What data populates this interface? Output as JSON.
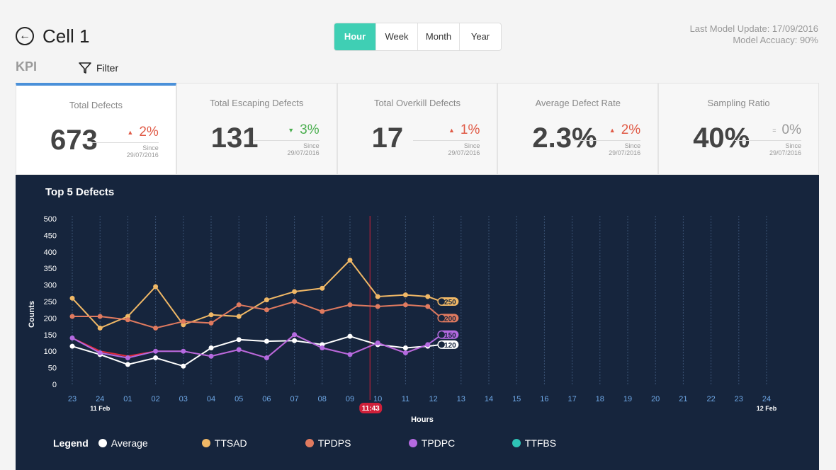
{
  "header": {
    "back_icon": "arrow-left-circle-icon",
    "title": "Cell 1",
    "kpi_label": "KPI",
    "filter_label": "Filter",
    "filter_icon": "funnel-icon",
    "last_update": "Last Model Update: 17/09/2016",
    "model_accuracy": "Model Accuacy: 90%"
  },
  "time_range": {
    "options": [
      "Hour",
      "Week",
      "Month",
      "Year"
    ],
    "selected": "Hour"
  },
  "kpi_cards": [
    {
      "title": "Total Defects",
      "value": "673",
      "direction": "up",
      "change": "2%",
      "since_label": "Since",
      "since_date": "29/07/2016",
      "color": "#e05a46",
      "active": true
    },
    {
      "title": "Total Escaping Defects",
      "value": "131",
      "direction": "down",
      "change": "3%",
      "since_label": "Since",
      "since_date": "29/07/2016",
      "color": "#4caf50",
      "active": false
    },
    {
      "title": "Total Overkill Defects",
      "value": "17",
      "direction": "up",
      "change": "1%",
      "since_label": "Since",
      "since_date": "29/07/2016",
      "color": "#e05a46",
      "active": false
    },
    {
      "title": "Average Defect Rate",
      "value": "2.3%",
      "direction": "up",
      "change": "2%",
      "since_label": "Since",
      "since_date": "29/07/2016",
      "color": "#e05a46",
      "active": false
    },
    {
      "title": "Sampling Ratio",
      "value": "40%",
      "direction": "equal",
      "change": "0%",
      "since_label": "Since",
      "since_date": "29/07/2016",
      "color": "#999999",
      "active": false
    }
  ],
  "chart_panel": {
    "title": "Top 5 Defects",
    "legend_title": "Legend"
  },
  "chart_data": {
    "type": "line",
    "title": "Top 5 Defects",
    "xlabel": "Hours",
    "ylabel": "Counts",
    "ylim": [
      0,
      500
    ],
    "yticks": [
      0,
      50,
      100,
      150,
      200,
      250,
      300,
      350,
      400,
      450,
      500
    ],
    "x_ticks": [
      "23",
      "24",
      "01",
      "02",
      "03",
      "04",
      "05",
      "06",
      "07",
      "08",
      "09",
      "10",
      "11",
      "12",
      "13",
      "14",
      "15",
      "16",
      "17",
      "18",
      "19",
      "20",
      "21",
      "22",
      "23",
      "24"
    ],
    "date_labels": [
      {
        "after_tick": "24",
        "index": 1,
        "label": "11 Feb"
      },
      {
        "after_tick": "24",
        "index": 25,
        "label": "12 Feb"
      }
    ],
    "now_marker": "11:43",
    "now_x": 10.72,
    "grid": true,
    "legend_position": "bottom",
    "series": [
      {
        "name": "Average",
        "color": "#ffffff",
        "x": [
          0,
          1,
          2,
          3,
          4,
          5,
          6,
          7,
          8,
          9,
          10,
          11,
          12,
          12.8,
          13.3
        ],
        "y": [
          115,
          90,
          60,
          80,
          55,
          110,
          135,
          130,
          132,
          120,
          145,
          120,
          110,
          115,
          120
        ],
        "end_label": "120"
      },
      {
        "name": "TTSAD",
        "color": "#f0b866",
        "x": [
          0,
          1,
          2,
          3,
          4,
          5,
          6,
          7,
          8,
          9,
          10,
          11,
          12,
          12.8,
          13.3
        ],
        "y": [
          260,
          170,
          205,
          295,
          180,
          210,
          205,
          255,
          280,
          290,
          375,
          265,
          270,
          265,
          250
        ],
        "end_label": "250"
      },
      {
        "name": "TPDPS",
        "color": "#e07a5f",
        "x": [
          0,
          1,
          2,
          3,
          4,
          5,
          6,
          7,
          8,
          9,
          10,
          11,
          12,
          12.8,
          13.3
        ],
        "y": [
          205,
          205,
          195,
          170,
          190,
          185,
          240,
          225,
          250,
          220,
          240,
          235,
          240,
          235,
          200
        ],
        "end_label": "200"
      },
      {
        "name": "TPDPC",
        "color": "#b46ae0",
        "x": [
          0,
          1,
          2,
          3,
          4,
          5,
          6,
          7,
          8,
          9,
          10,
          11,
          12,
          12.8,
          13.3
        ],
        "y": [
          140,
          95,
          80,
          100,
          100,
          85,
          105,
          80,
          150,
          110,
          90,
          125,
          95,
          120,
          150
        ],
        "end_label": "150"
      },
      {
        "name": "TTFBS",
        "color": "#2ec4b6",
        "x": [],
        "y": []
      }
    ],
    "extra_line": {
      "name": "",
      "color": "#e02a3a",
      "x": [
        0,
        1,
        2,
        3,
        4,
        5,
        6,
        7,
        8,
        9,
        10,
        11,
        12,
        12.8
      ],
      "y": [
        140,
        100,
        85,
        100,
        100,
        85,
        105,
        80,
        150,
        110,
        90,
        125,
        95,
        120
      ]
    }
  }
}
